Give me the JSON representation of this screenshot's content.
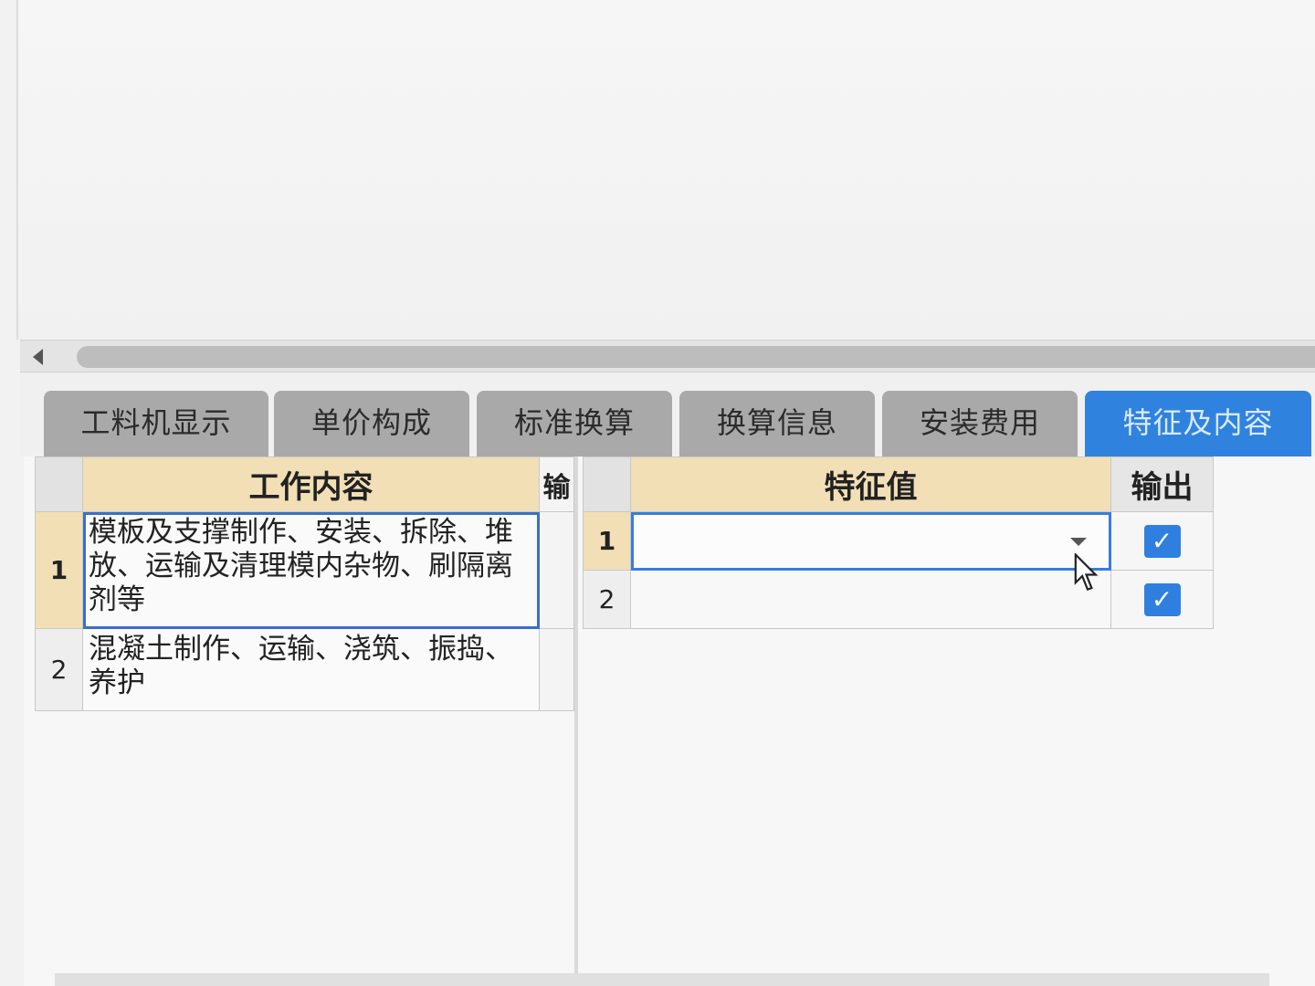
{
  "tabs": [
    {
      "label": "工料机显示",
      "active": false
    },
    {
      "label": "单价构成",
      "active": false
    },
    {
      "label": "标准换算",
      "active": false
    },
    {
      "label": "换算信息",
      "active": false
    },
    {
      "label": "安装费用",
      "active": false
    },
    {
      "label": "特征及内容",
      "active": true
    }
  ],
  "work_table": {
    "header": "工作内容",
    "narrow_header": "输",
    "rows": [
      {
        "num": "1",
        "text": "模板及支撑制作、安装、拆除、堆放、运输及清理模内杂物、刷隔离剂等"
      },
      {
        "num": "2",
        "text": "混凝土制作、运输、浇筑、振捣、养护"
      }
    ]
  },
  "feature_table": {
    "value_header": "特征值",
    "output_header": "输出",
    "rows": [
      {
        "num": "1",
        "value": "",
        "output": true
      },
      {
        "num": "2",
        "value": "",
        "output": true
      }
    ]
  },
  "colors": {
    "active_tab": "#2f83df",
    "header_bg": "#f2dfb6",
    "checkbox": "#2f7fe0"
  }
}
